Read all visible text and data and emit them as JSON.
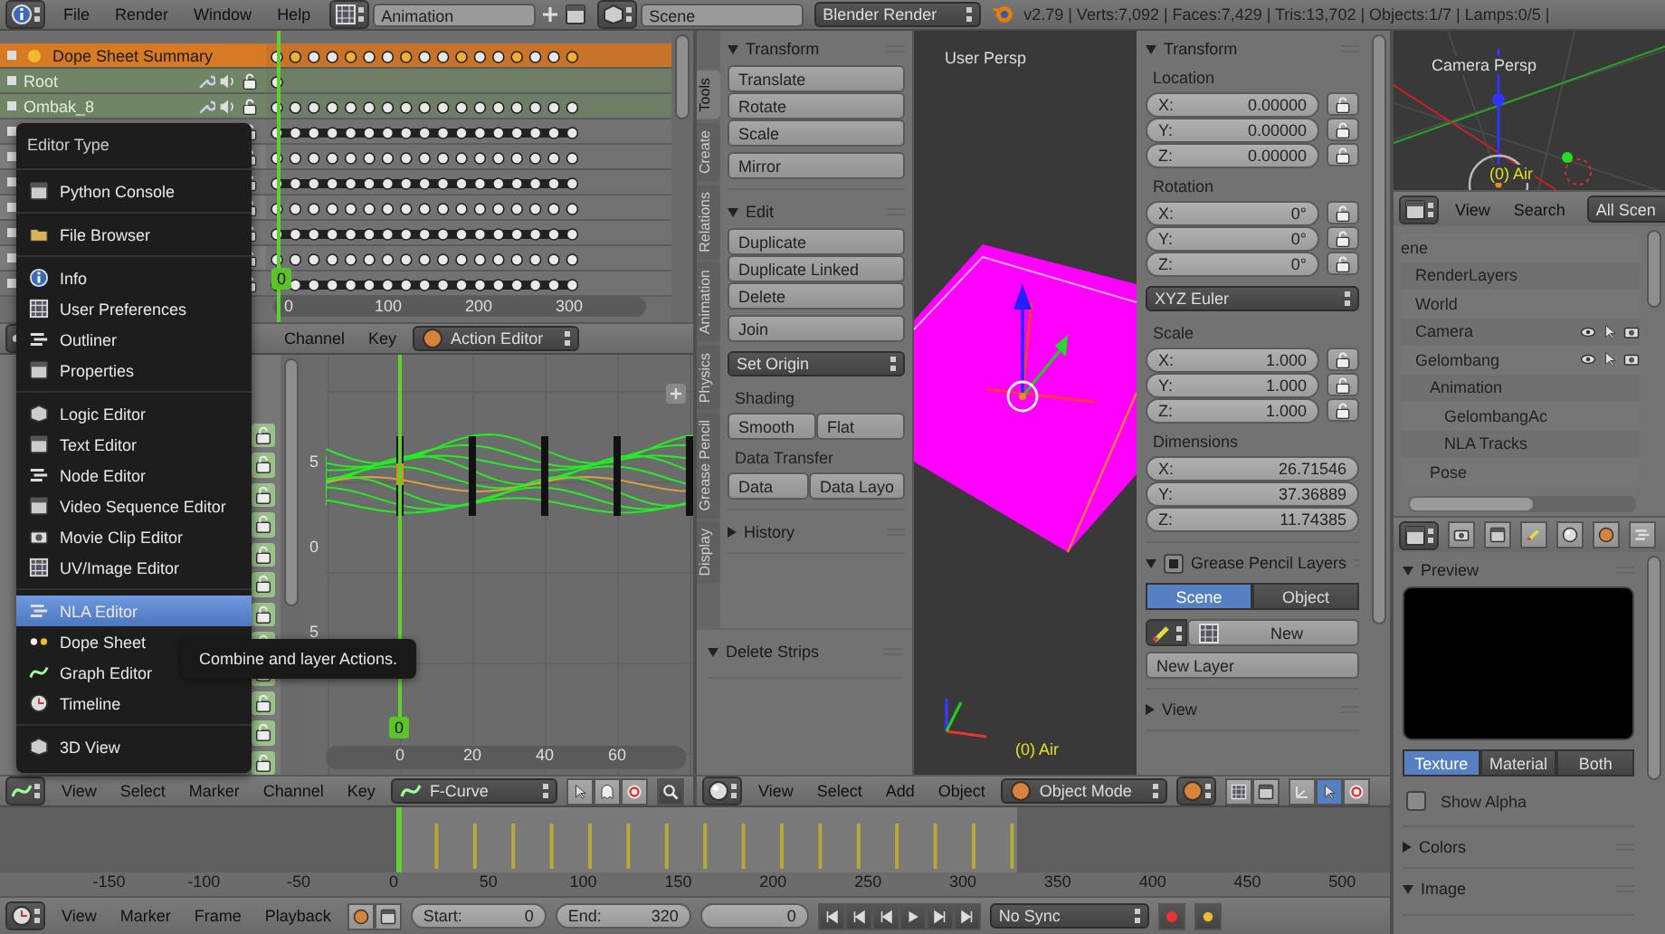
{
  "top_bar": {
    "menus": [
      "File",
      "Render",
      "Window",
      "Help"
    ],
    "screen_layout": "Animation",
    "scene": "Scene",
    "render_engine": "Blender Render",
    "stats": "v2.79 | Verts:7,092 | Faces:7,429 | Tris:13,702 | Objects:1/7 | Lamps:0/5 |"
  },
  "dope_sheet": {
    "channels": [
      {
        "kind": "summary",
        "name": "Dope Sheet Summary"
      },
      {
        "kind": "group",
        "name": "Root"
      },
      {
        "kind": "group",
        "name": "Ombak_8"
      },
      {
        "kind": "channel"
      },
      {
        "kind": "channel"
      },
      {
        "kind": "channel"
      },
      {
        "kind": "channel"
      },
      {
        "kind": "channel"
      },
      {
        "kind": "channel"
      },
      {
        "kind": "channel"
      }
    ],
    "ruler": [
      "0",
      "100",
      "200",
      "300"
    ],
    "current_frame": "0",
    "header": {
      "menus": [
        "Channel",
        "Key"
      ],
      "mode": "Action Editor"
    }
  },
  "graph_editor": {
    "y_labels": [
      "5",
      "0",
      "5"
    ],
    "x_labels": [
      "0",
      "20",
      "40",
      "60"
    ],
    "current_frame": "0",
    "header": {
      "menus": [
        "View",
        "Select",
        "Marker",
        "Channel",
        "Key"
      ],
      "mode": "F-Curve"
    }
  },
  "tool_shelf": {
    "tabs": [
      {
        "label": "Tools",
        "selected": true
      },
      {
        "label": "Create",
        "selected": false
      },
      {
        "label": "Relations",
        "selected": false
      },
      {
        "label": "Animation",
        "selected": false
      },
      {
        "label": "Physics",
        "selected": false
      },
      {
        "label": "Grease Pencil",
        "selected": false
      },
      {
        "label": "Display",
        "selected": false
      }
    ],
    "panels": [
      {
        "title": "Transform",
        "expanded": true,
        "items": [
          {
            "kind": "buttons",
            "labels": [
              "Translate",
              "Rotate",
              "Scale"
            ]
          },
          {
            "kind": "buttons",
            "labels": [
              "Mirror"
            ]
          }
        ]
      },
      {
        "title": "Edit",
        "expanded": true,
        "items": [
          {
            "kind": "buttons",
            "labels": [
              "Duplicate",
              "Duplicate Linked",
              "Delete"
            ]
          },
          {
            "kind": "buttons",
            "labels": [
              "Join"
            ]
          },
          {
            "kind": "dropdown",
            "label": "Set Origin"
          },
          {
            "kind": "label",
            "label": "Shading"
          },
          {
            "kind": "row",
            "labels": [
              "Smooth",
              "Flat"
            ]
          },
          {
            "kind": "label",
            "label": "Data Transfer"
          },
          {
            "kind": "row",
            "labels": [
              "Data",
              "Data Layo"
            ]
          }
        ]
      },
      {
        "title": "History",
        "expanded": false
      }
    ],
    "redo_panel": {
      "title": "Delete Strips",
      "expanded": true
    }
  },
  "viewport": {
    "view_name": "User Persp",
    "object_label": "(0) Air"
  },
  "n_panel": {
    "panels": [
      {
        "title": "Transform",
        "expanded": true,
        "items": [
          {
            "kind": "label",
            "label": "Location"
          },
          {
            "kind": "vector",
            "locks": true,
            "fields": [
              {
                "axis": "X:",
                "value": "0.00000"
              },
              {
                "axis": "Y:",
                "value": "0.00000"
              },
              {
                "axis": "Z:",
                "value": "0.00000"
              }
            ]
          },
          {
            "kind": "label",
            "label": "Rotation"
          },
          {
            "kind": "vector",
            "locks": true,
            "fields": [
              {
                "axis": "X:",
                "value": "0°"
              },
              {
                "axis": "Y:",
                "value": "0°"
              },
              {
                "axis": "Z:",
                "value": "0°"
              }
            ]
          },
          {
            "kind": "dropdown",
            "label": "XYZ Euler"
          },
          {
            "kind": "label",
            "label": "Scale"
          },
          {
            "kind": "vector",
            "locks": true,
            "fields": [
              {
                "axis": "X:",
                "value": "1.000"
              },
              {
                "axis": "Y:",
                "value": "1.000"
              },
              {
                "axis": "Z:",
                "value": "1.000"
              }
            ]
          },
          {
            "kind": "label",
            "label": "Dimensions"
          },
          {
            "kind": "vector",
            "locks": false,
            "fields": [
              {
                "axis": "X:",
                "value": "26.71546"
              },
              {
                "axis": "Y:",
                "value": "37.36889"
              },
              {
                "axis": "Z:",
                "value": "11.74385"
              }
            ]
          }
        ]
      },
      {
        "title": "Grease Pencil Layers",
        "expanded": true,
        "checked": true,
        "items": [
          {
            "kind": "toggle",
            "options": [
              {
                "label": "Scene",
                "selected": true
              },
              {
                "label": "Object",
                "selected": false
              }
            ]
          },
          {
            "kind": "new_row",
            "label": "New"
          },
          {
            "kind": "buttons",
            "labels": [
              "New Layer"
            ]
          }
        ]
      },
      {
        "title": "View",
        "expanded": false
      }
    ]
  },
  "view_header": {
    "menus": [
      "View",
      "Select",
      "Add",
      "Object"
    ],
    "mode": "Object Mode"
  },
  "camera_view": {
    "view_name": "Camera Persp",
    "object_label": "(0) Air"
  },
  "outliner": {
    "header": {
      "menus": [
        "View",
        "Search"
      ],
      "filter": "All Scen"
    },
    "tree": [
      {
        "name": "ene",
        "children": [
          {
            "name": "RenderLayers"
          },
          {
            "name": "World"
          },
          {
            "name": "Camera",
            "restrict_icons": true
          },
          {
            "name": "Gelombang",
            "restrict_icons": true,
            "children": [
              {
                "name": "Animation",
                "children": [
                  {
                    "name": "GelombangAc"
                  },
                  {
                    "name": "NLA Tracks"
                  }
                ]
              },
              {
                "name": "Pose"
              }
            ]
          }
        ]
      }
    ]
  },
  "properties": {
    "panels": [
      {
        "title": "Preview",
        "expanded": true,
        "kind": "preview",
        "tabs": [
          {
            "label": "Texture",
            "selected": true
          },
          {
            "label": "Material",
            "selected": false
          },
          {
            "label": "Both",
            "selected": false
          }
        ],
        "show_alpha": {
          "label": "Show Alpha",
          "checked": false
        }
      },
      {
        "title": "Colors",
        "expanded": false
      },
      {
        "title": "Image",
        "expanded": true
      }
    ]
  },
  "timeline": {
    "ruler": [
      "-150",
      "-100",
      "-50",
      "0",
      "50",
      "100",
      "150",
      "200",
      "250",
      "300",
      "350",
      "400",
      "450",
      "500"
    ],
    "header": {
      "menus": [
        "View",
        "Marker",
        "Frame",
        "Playback"
      ],
      "start": {
        "label": "Start:",
        "value": "0"
      },
      "end": {
        "label": "End:",
        "value": "320"
      },
      "current": "0",
      "sync": "No Sync"
    }
  },
  "editor_menu": {
    "title": "Editor Type",
    "groups": [
      [
        {
          "label": "Python Console",
          "selected": false
        }
      ],
      [
        {
          "label": "File Browser",
          "selected": false
        }
      ],
      [
        {
          "label": "Info",
          "selected": false
        },
        {
          "label": "User Preferences",
          "selected": false
        },
        {
          "label": "Outliner",
          "selected": false
        },
        {
          "label": "Properties",
          "selected": false
        }
      ],
      [
        {
          "label": "Logic Editor",
          "selected": false
        },
        {
          "label": "Text Editor",
          "selected": false
        },
        {
          "label": "Node Editor",
          "selected": false
        },
        {
          "label": "Video Sequence Editor",
          "selected": false
        },
        {
          "label": "Movie Clip Editor",
          "selected": false
        },
        {
          "label": "UV/Image Editor",
          "selected": false
        }
      ],
      [
        {
          "label": "NLA Editor",
          "selected": true
        },
        {
          "label": "Dope Sheet",
          "selected": false
        },
        {
          "label": "Graph Editor",
          "selected": false
        },
        {
          "label": "Timeline",
          "selected": false
        }
      ],
      [
        {
          "label": "3D View",
          "selected": false
        }
      ]
    ]
  },
  "tooltip": "Combine and layer Actions."
}
